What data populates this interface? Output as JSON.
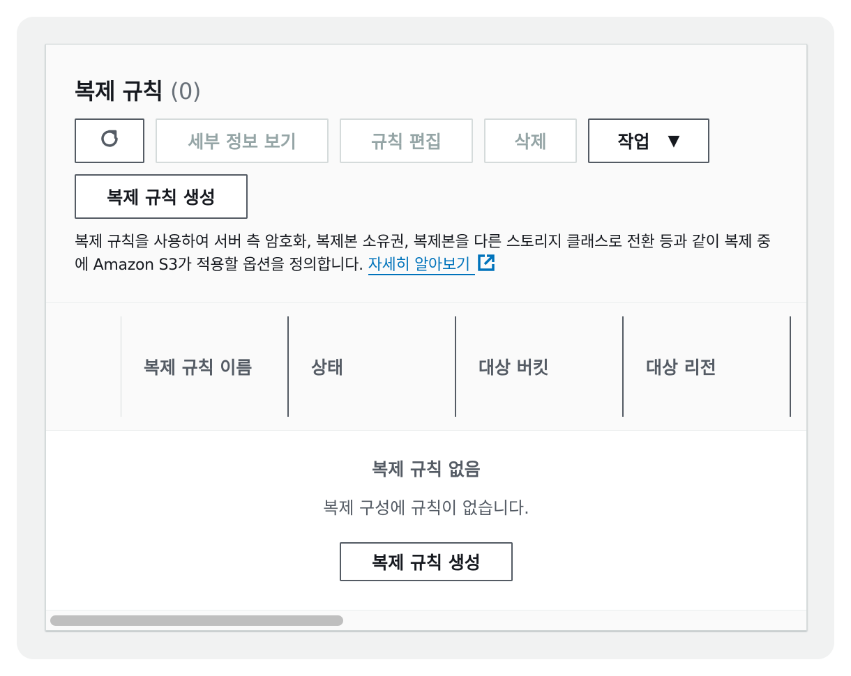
{
  "title": {
    "text": "복제 규칙",
    "count": "(0)"
  },
  "toolbar": {
    "refresh_icon": "refresh-icon",
    "view_details": "세부 정보 보기",
    "edit_rule": "규칙 편집",
    "delete": "삭제",
    "actions": "작업",
    "actions_caret": "▼",
    "create_rule": "복제 규칙 생성"
  },
  "description": {
    "text": "복제 규칙을 사용하여 서버 측 암호화, 복제본 소유권, 복제본을 다른 스토리지 클래스로 전환 등과 같이 복제 중에 Amazon S3가 적용할 옵션을 정의합니다.",
    "link": "자세히 알아보기",
    "link_icon": "external-link-icon"
  },
  "table": {
    "columns": [
      "복제 규칙 이름",
      "상태",
      "대상 버킷",
      "대상 리전"
    ]
  },
  "empty_state": {
    "title": "복제 규칙 없음",
    "message": "복제 구성에 규칙이 없습니다.",
    "button": "복제 규칙 생성"
  },
  "colors": {
    "link": "#0073bb",
    "border": "#545b64",
    "disabled_text": "#95a5a6"
  }
}
